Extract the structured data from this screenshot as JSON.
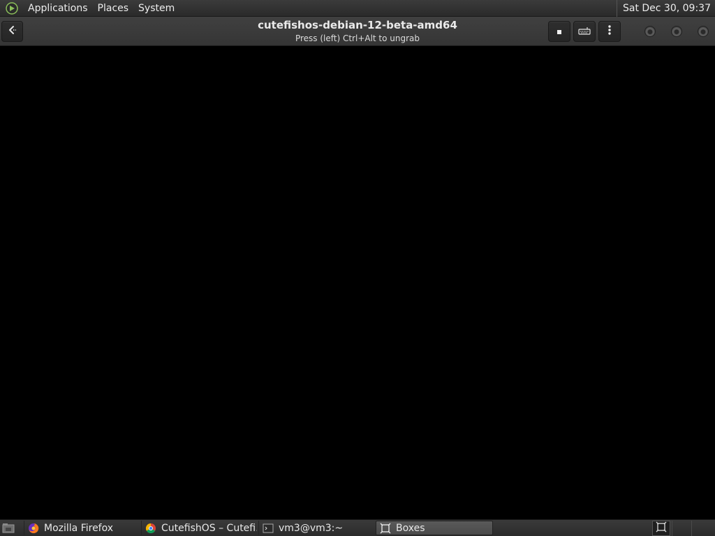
{
  "top_panel": {
    "menus": [
      "Applications",
      "Places",
      "System"
    ],
    "clock": "Sat Dec 30, 09:37"
  },
  "headerbar": {
    "title": "cutefishos-debian-12-beta-amd64",
    "subtitle": "Press (left) Ctrl+Alt to ungrab",
    "icons": {
      "back": "back-arrow-icon",
      "stop": "stop-icon",
      "keyboard": "keyboard-icon",
      "more": "more-vertical-icon"
    }
  },
  "taskbar": {
    "tasks": [
      {
        "label": "Mozilla Firefox",
        "icon": "firefox-icon"
      },
      {
        "label": "CutefishOS – Cutefi…",
        "icon": "chrome-icon"
      },
      {
        "label": "vm3@vm3:~",
        "icon": "terminal-icon"
      },
      {
        "label": "Boxes",
        "icon": "boxes-icon",
        "active": true
      }
    ]
  },
  "colors": {
    "panel": "#2e2e2e",
    "headerbar": "#3a3a3a",
    "vm_display": "#000000",
    "active_task": "#505050"
  }
}
